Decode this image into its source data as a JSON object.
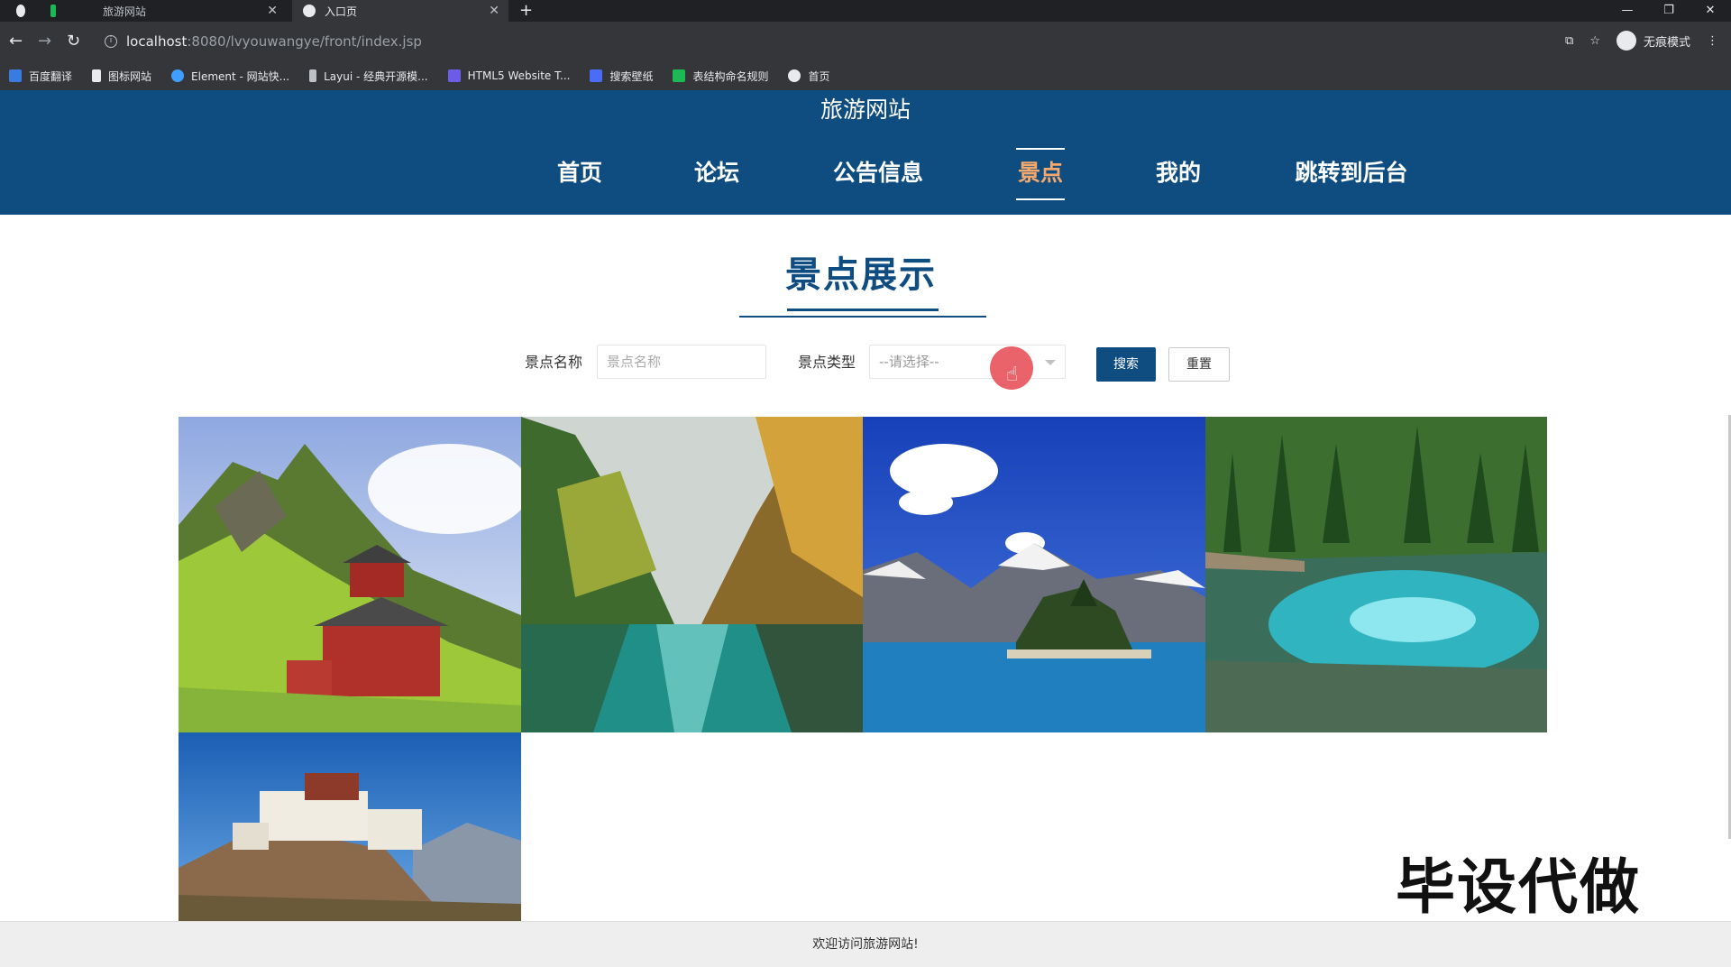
{
  "browser": {
    "tabs": [
      {
        "label": "旅游网站"
      },
      {
        "label": "入口页"
      }
    ],
    "url_host": "localhost",
    "url_path": ":8080/lvyouwangye/front/index.jsp",
    "incognito_label": "无痕模式",
    "bookmarks": [
      {
        "label": "百度翻译",
        "color": "#3a7be0"
      },
      {
        "label": "图标网站",
        "color": "#e8eaed"
      },
      {
        "label": "Element - 网站快...",
        "color": "#409eff"
      },
      {
        "label": "Layui - 经典开源模...",
        "color": "#bdc1c6"
      },
      {
        "label": "HTML5 Website T...",
        "color": "#6c5ce7"
      },
      {
        "label": "搜索壁纸",
        "color": "#4a6cf7"
      },
      {
        "label": "表结构命名规则",
        "color": "#1db954"
      },
      {
        "label": "首页",
        "color": "#e8eaed"
      }
    ]
  },
  "site": {
    "title": "旅游网站",
    "nav": [
      {
        "label": "首页"
      },
      {
        "label": "论坛"
      },
      {
        "label": "公告信息"
      },
      {
        "label": "景点"
      },
      {
        "label": "我的"
      },
      {
        "label": "跳转到后台"
      }
    ],
    "active_nav": "景点",
    "accent_color": "#0f4d80",
    "active_color": "#f5a86b"
  },
  "main": {
    "section_title": "景点展示",
    "search": {
      "name_label": "景点名称",
      "name_placeholder": "景点名称",
      "type_label": "景点类型",
      "type_selected": "--请选择--",
      "search_button": "搜索",
      "reset_button": "重置"
    },
    "watermark": "毕设代做"
  },
  "footer": {
    "text": "欢迎访问旅游网站!"
  }
}
